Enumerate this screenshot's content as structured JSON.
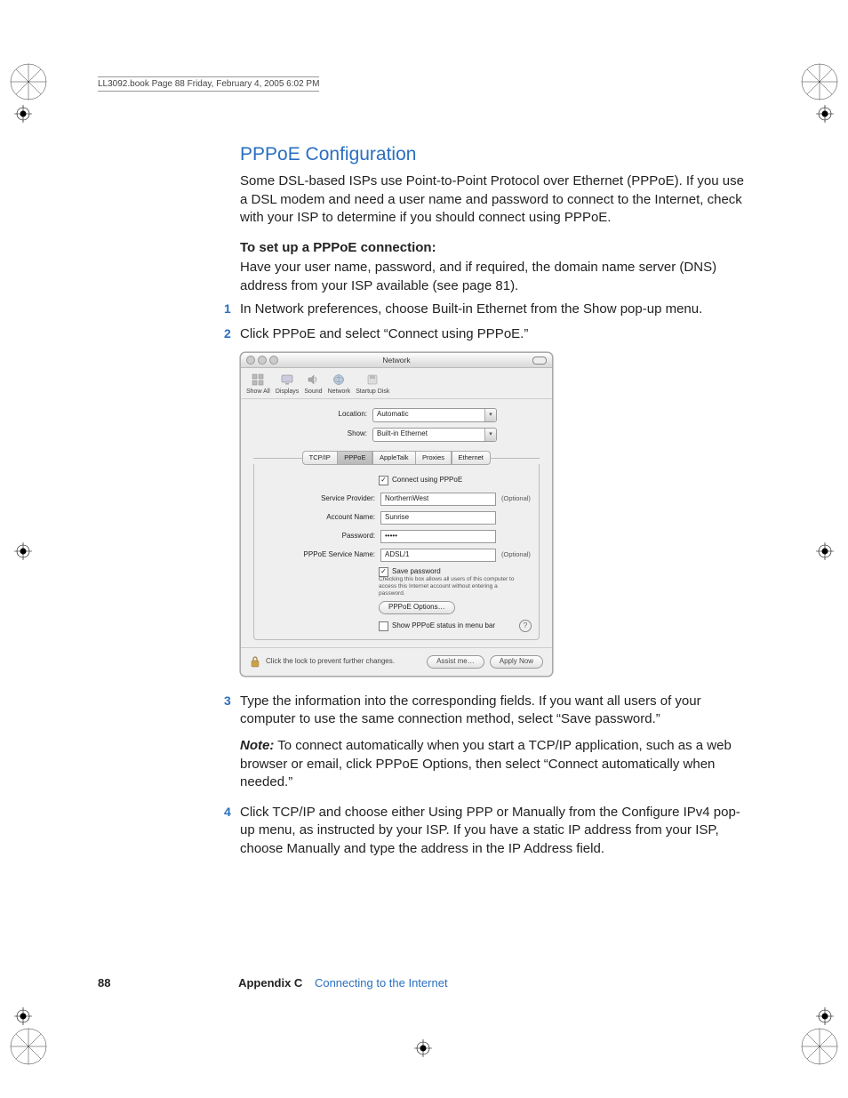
{
  "headerLine": "LL3092.book  Page 88  Friday, February 4, 2005  6:02 PM",
  "section": {
    "title": "PPPoE Configuration",
    "intro": "Some DSL-based ISPs use Point-to-Point Protocol over Ethernet (PPPoE). If you use a DSL modem and need a user name and password to connect to the Internet, check with your ISP to determine if you should connect using PPPoE.",
    "setupHeading": "To set up a PPPoE connection:",
    "setupLead": "Have your user name, password, and if required, the domain name server (DNS) address from your ISP available (see page 81).",
    "step1": "In Network preferences, choose Built-in Ethernet from the Show pop-up menu.",
    "step2": "Click PPPoE and select “Connect using PPPoE.”",
    "step3": "Type the information into the corresponding fields. If you want all users of your computer to use the same connection method, select “Save password.”",
    "noteLabel": "Note:",
    "noteText": "  To connect automatically when you start a TCP/IP application, such as a web browser or email, click PPPoE Options, then select “Connect automatically when needed.”",
    "step4": "Click TCP/IP and choose either Using PPP or Manually from the Configure IPv4 pop-up menu, as instructed by your ISP. If you have a static IP address from your ISP, choose Manually and type the address in the IP Address field."
  },
  "macwin": {
    "title": "Network",
    "toolbar": {
      "showAll": "Show All",
      "displays": "Displays",
      "sound": "Sound",
      "network": "Network",
      "startupDisk": "Startup Disk"
    },
    "locationLabel": "Location:",
    "locationValue": "Automatic",
    "showLabel": "Show:",
    "showValue": "Built-in Ethernet",
    "tabs": {
      "tcpip": "TCP/IP",
      "pppoe": "PPPoE",
      "appletalk": "AppleTalk",
      "proxies": "Proxies",
      "ethernet": "Ethernet"
    },
    "connectUsing": "Connect using PPPoE",
    "serviceProviderLabel": "Service Provider:",
    "serviceProviderValue": "NorthernWest",
    "accountNameLabel": "Account Name:",
    "accountNameValue": "Sunrise",
    "passwordLabel": "Password:",
    "passwordValue": "•••••",
    "pppoeServiceLabel": "PPPoE Service Name:",
    "pppoeServiceValue": "ADSL/1",
    "optional": "(Optional)",
    "savePassword": "Save password",
    "savePasswordHelp": "Checking this box allows all users of this computer to access this Internet account without entering a password.",
    "pppoeOptionsBtn": "PPPoE Options…",
    "showStatus": "Show PPPoE status in menu bar",
    "lockText": "Click the lock to prevent further changes.",
    "assistBtn": "Assist me…",
    "applyBtn": "Apply Now"
  },
  "footer": {
    "pageNum": "88",
    "appendix": "Appendix C",
    "chapter": "Connecting to the Internet"
  }
}
